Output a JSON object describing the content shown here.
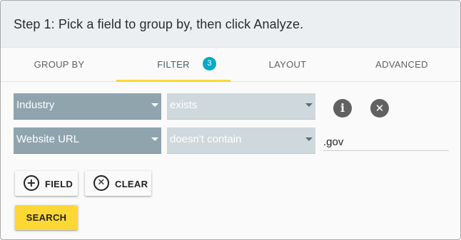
{
  "header": {
    "title": "Step 1: Pick a field to group by, then click Analyze."
  },
  "tabs": [
    {
      "label": "GROUP BY"
    },
    {
      "label": "FILTER",
      "badge": "3"
    },
    {
      "label": "LAYOUT"
    },
    {
      "label": "ADVANCED"
    }
  ],
  "filters": [
    {
      "field": "Industry",
      "operator": "exists",
      "value": ""
    },
    {
      "field": "Website URL",
      "operator": "doesn't contain",
      "value": ".gov"
    }
  ],
  "buttons": {
    "field_label": "FIELD",
    "clear_label": "CLEAR",
    "search_label": "SEARCH"
  },
  "icons": {
    "info": "info-icon",
    "remove": "close-circle-icon",
    "add": "add-circle-icon",
    "clear": "cancel-circle-icon"
  },
  "colors": {
    "header_bg": "#eceff1",
    "accent": "#fdd835",
    "badge": "#03a9c6",
    "field_select": "#90a4ae",
    "operator_select": "#cfd8dc"
  }
}
